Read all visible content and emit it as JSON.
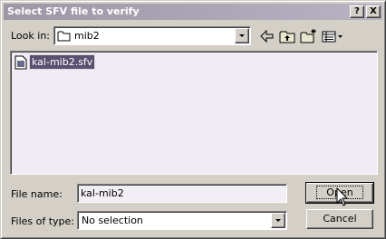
{
  "window": {
    "title": "Select SFV file to verify",
    "help_glyph": "?",
    "close_glyph": "X"
  },
  "look_in": {
    "label": "Look in:",
    "value": "mib2"
  },
  "toolbar": {
    "icons": [
      "back-icon",
      "up-folder-icon",
      "new-folder-icon",
      "view-menu-icon"
    ]
  },
  "files": [
    {
      "name": "kal-mib2.sfv",
      "selected": true
    }
  ],
  "filename": {
    "label": "File name:",
    "value": "kal-mib2"
  },
  "filetype": {
    "label": "Files of type:",
    "value": "No selection"
  },
  "buttons": {
    "open": "Open",
    "cancel": "Cancel"
  },
  "colors": {
    "titlebar": "#9c96a6",
    "selection": "#5a5170",
    "list_bg": "#f0ebf4"
  }
}
